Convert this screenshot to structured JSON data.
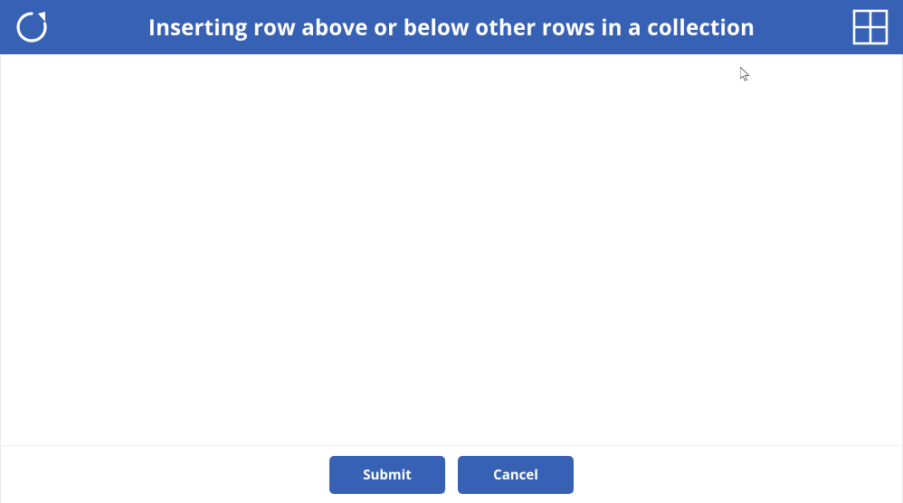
{
  "header": {
    "title": "Inserting row above or below other rows in a collection",
    "refresh_icon_name": "refresh-icon",
    "add_icon_name": "add-cell-icon"
  },
  "footer": {
    "submit_label": "Submit",
    "cancel_label": "Cancel"
  },
  "colors": {
    "accent": "#3761b5",
    "button": "#3761b5",
    "text_on_accent": "#ffffff"
  }
}
